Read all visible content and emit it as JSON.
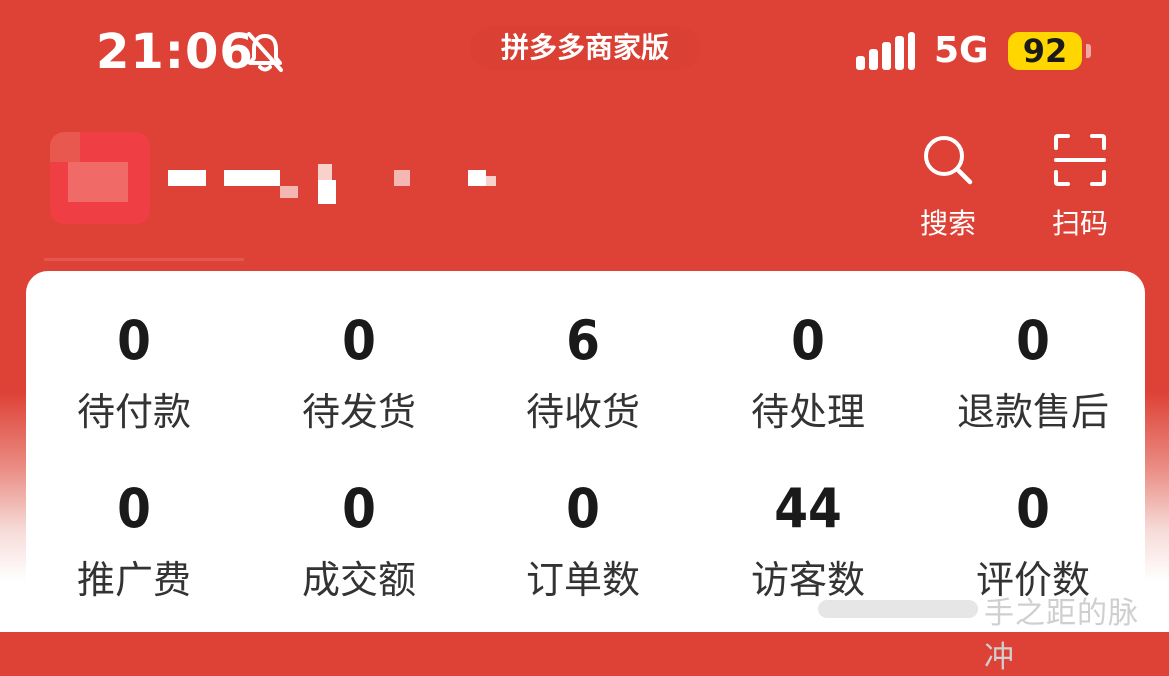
{
  "status_bar": {
    "time": "21:06",
    "app_name": "拼多多商家版",
    "network": "5G",
    "battery": "92"
  },
  "header": {
    "search_label": "搜索",
    "scan_label": "扫码"
  },
  "stats_row1": [
    {
      "value": "0",
      "label": "待付款"
    },
    {
      "value": "0",
      "label": "待发货"
    },
    {
      "value": "6",
      "label": "待收货"
    },
    {
      "value": "0",
      "label": "待处理"
    },
    {
      "value": "0",
      "label": "退款售后"
    }
  ],
  "stats_row2": [
    {
      "value": "0",
      "label": "推广费"
    },
    {
      "value": "0",
      "label": "成交额"
    },
    {
      "value": "0",
      "label": "订单数"
    },
    {
      "value": "44",
      "label": "访客数"
    },
    {
      "value": "0",
      "label": "评价数"
    }
  ],
  "watermark": "手之距的脉冲",
  "colors": {
    "brand_red": "#de4135",
    "battery_yellow": "#ffd600"
  }
}
